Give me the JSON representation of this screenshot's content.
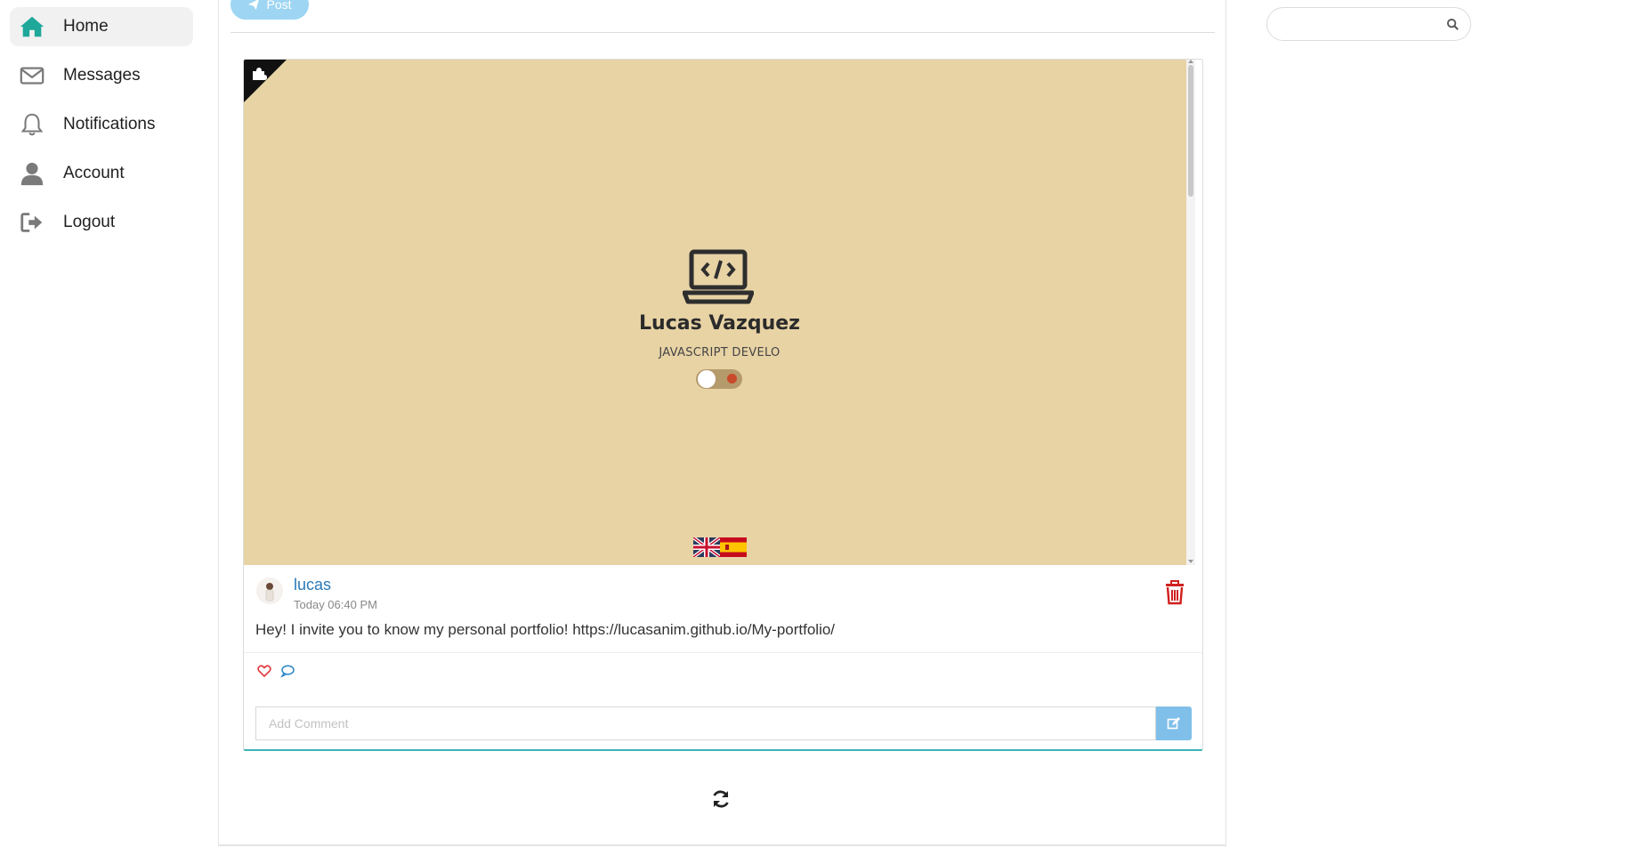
{
  "sidebar": {
    "items": [
      {
        "label": "Home",
        "icon": "home-icon",
        "active": true
      },
      {
        "label": "Messages",
        "icon": "envelope-icon",
        "active": false
      },
      {
        "label": "Notifications",
        "icon": "bell-icon",
        "active": false
      },
      {
        "label": "Account",
        "icon": "user-icon",
        "active": false
      },
      {
        "label": "Logout",
        "icon": "sign-out-icon",
        "active": false
      }
    ],
    "active_color": "#1fa79a",
    "icon_color": "#7a7a7a"
  },
  "composer": {
    "post_label": "Post",
    "post_button_color": "#9dd5f3"
  },
  "post": {
    "preview": {
      "name": "Lucas Vazquez",
      "role": "JAVASCRIPT DEVELO",
      "background": "#e8d3a5",
      "flags": [
        "uk-flag-icon",
        "spain-flag-icon"
      ]
    },
    "author": "lucas",
    "time": "Today 06:40 PM",
    "text": "Hey! I invite you to know my personal portfolio! https://lucasanim.github.io/My-portfolio/",
    "author_color": "#2a7ab8",
    "delete_color": "#d0201f",
    "like_color": "#e0383e",
    "comment_color": "#2a88c8",
    "comment_placeholder": "Add Comment",
    "card_accent": "#39b3b7"
  },
  "search": {
    "placeholder": ""
  }
}
